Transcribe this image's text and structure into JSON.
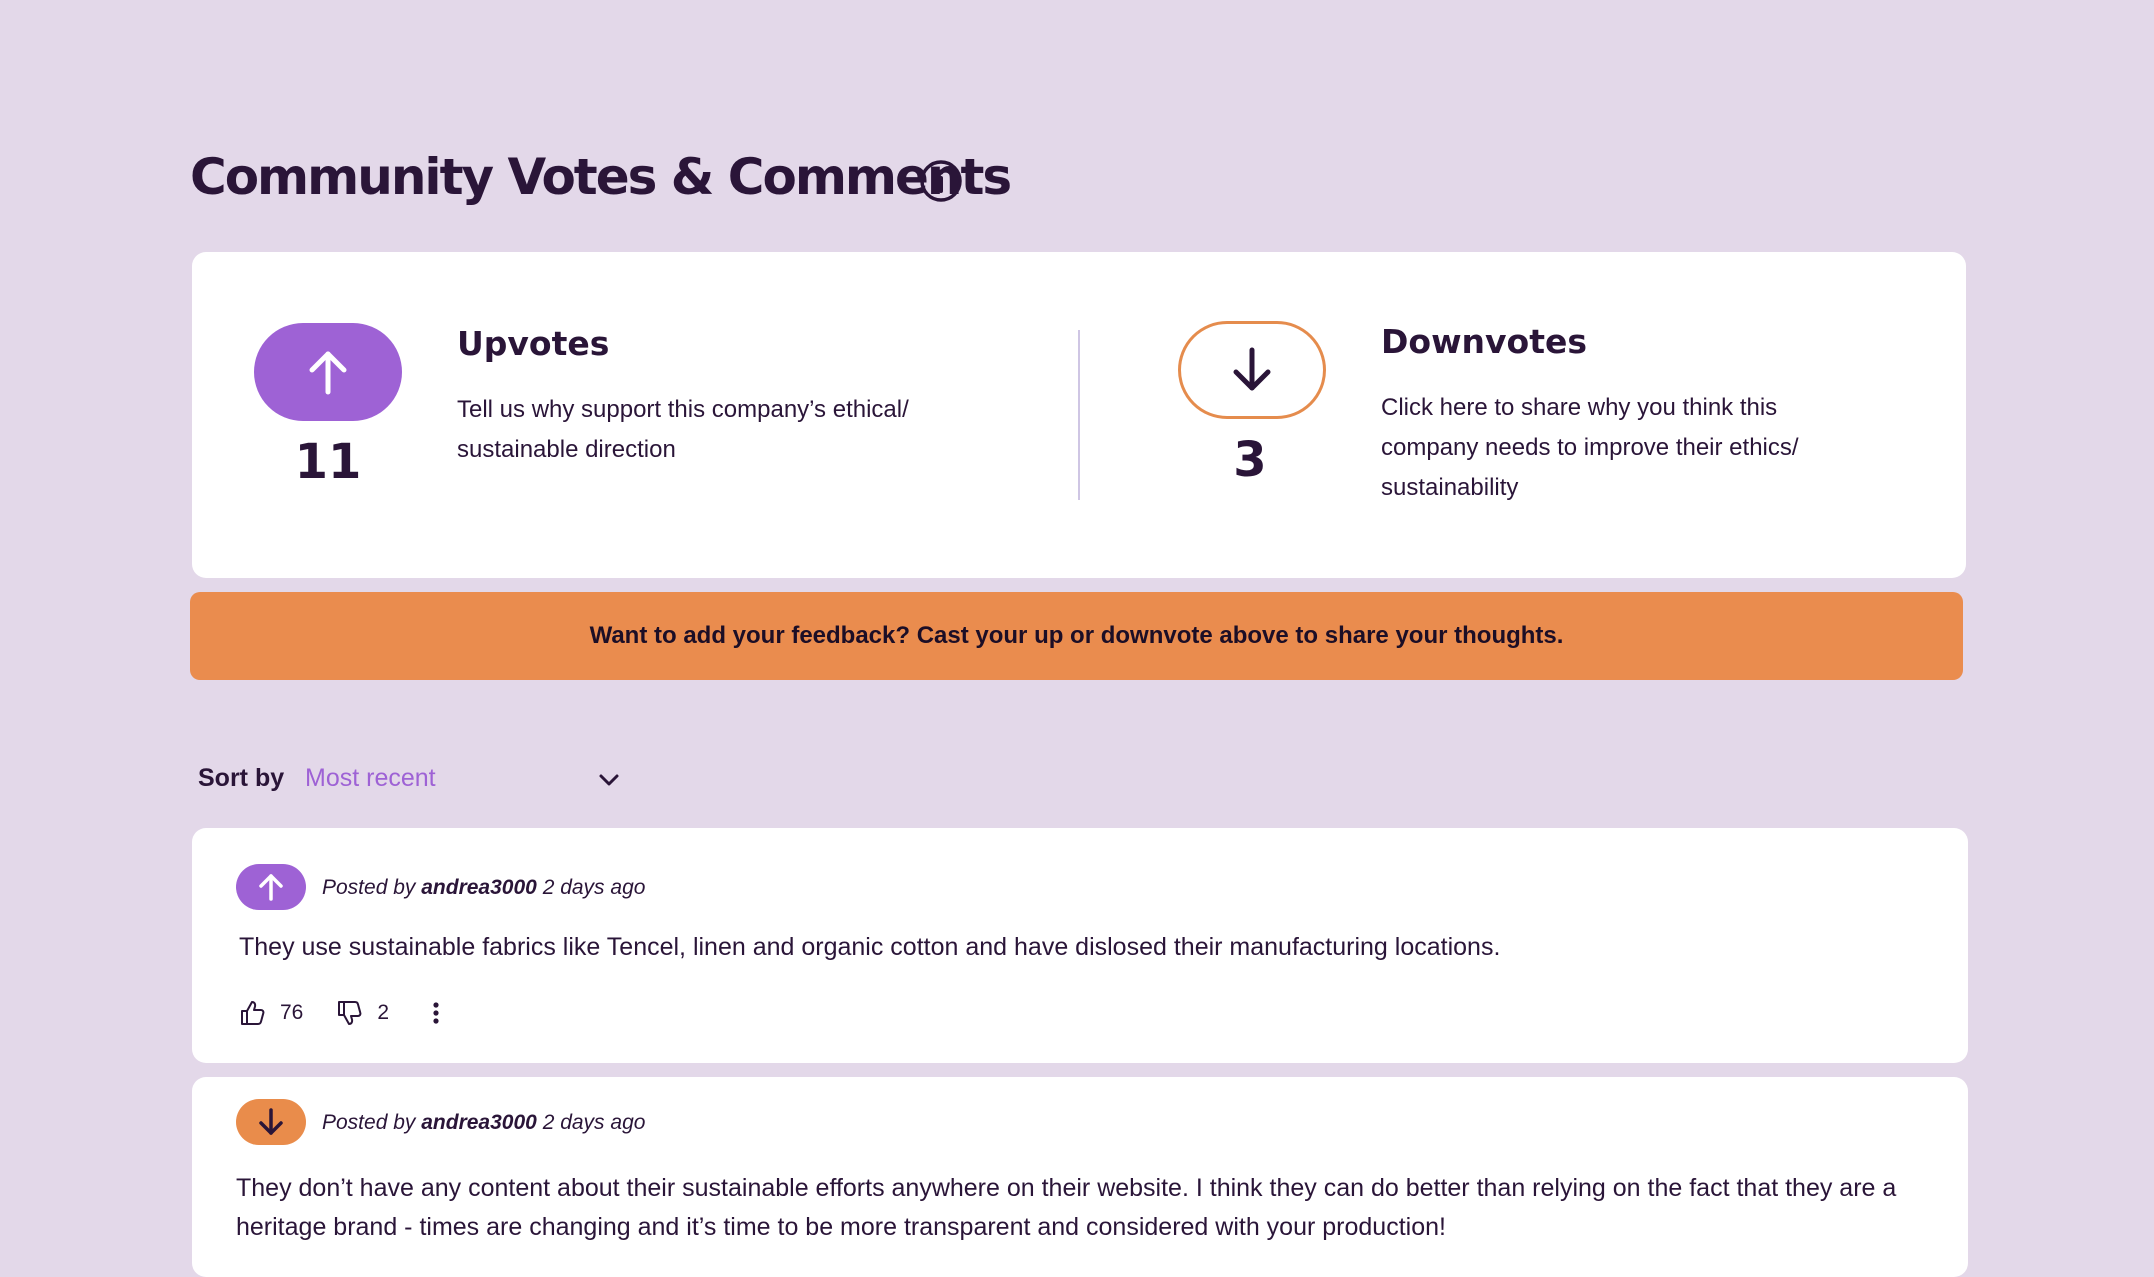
{
  "header": {
    "title": "Community Votes & Comments",
    "info_icon": "info-circle-icon"
  },
  "votes": {
    "upvotes": {
      "icon": "arrow-up-icon",
      "count": "11",
      "heading": "Upvotes",
      "description": "Tell us why support this company’s ethical/ sustainable direction",
      "color": "#9e62d5"
    },
    "downvotes": {
      "icon": "arrow-down-icon",
      "count": "3",
      "heading": "Downvotes",
      "description": "Click here to share why you think  this company needs to improve their ethics/ sustainability",
      "color": "#e58c4d"
    }
  },
  "banner": {
    "text": "Want to add your feedback? Cast your up or downvote above to share your thoughts.",
    "color": "#ea8c4e"
  },
  "sort": {
    "label": "Sort by",
    "value": "Most recent",
    "icon": "chevron-down-icon"
  },
  "comments": [
    {
      "vote": "up",
      "posted_prefix": "Posted by",
      "author": "andrea3000",
      "time": "2 days ago",
      "text": "They use sustainable fabrics like Tencel, linen and organic cotton and have dislosed their manufacturing locations.",
      "likes": "76",
      "dislikes": "2"
    },
    {
      "vote": "down",
      "posted_prefix": "Posted by",
      "author": "andrea3000",
      "time": "2 days ago",
      "text": "They don’t have any content about their sustainable efforts anywhere on their website. I think they can do better than relying on the fact that they are a heritage brand - times are changing and it’s time to be more transparent and considered with your production!"
    }
  ]
}
